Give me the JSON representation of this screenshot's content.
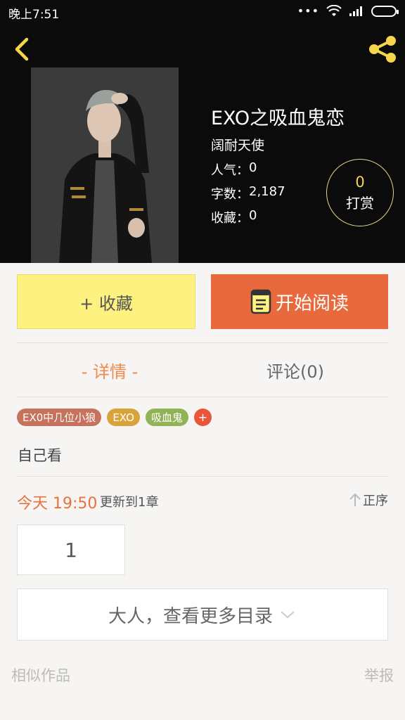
{
  "status_bar": {
    "time": "晚上7:51",
    "dots": "•••"
  },
  "header": {
    "back_icon": "chevron-left-icon",
    "share_icon": "share-icon",
    "accent": "#f5d54a"
  },
  "book": {
    "title": "EXO之吸血鬼恋",
    "author": "阔耐天使",
    "popularity_label": "人气：",
    "popularity_value": "0",
    "words_label": "字数：",
    "words_value": "2,187",
    "favorites_label": "收藏：",
    "favorites_value": "0",
    "tip_count": "0",
    "tip_label": "打赏"
  },
  "actions": {
    "favorite_label": "+ 收藏",
    "read_label": "开始阅读",
    "favorite_color": "#fdf27f",
    "read_color": "#e86a3c"
  },
  "tabs": {
    "detail_label": "- 详情 -",
    "comments_label": "评论(0)"
  },
  "tags": [
    {
      "label": "EX0中几位小狼",
      "color": "#c6725c"
    },
    {
      "label": "EXO",
      "color": "#d9a33b"
    },
    {
      "label": "吸血鬼",
      "color": "#8fb356"
    },
    {
      "label": "+",
      "color": "#e8573a"
    }
  ],
  "description": "自己看",
  "update": {
    "time": "今天 19:50",
    "text": "更新到1章",
    "order_label": "正序"
  },
  "chapters": [
    "1"
  ],
  "more_catalog": "大人，查看更多目录",
  "footer": {
    "similar_label": "相似作品",
    "report_label": "举报"
  }
}
